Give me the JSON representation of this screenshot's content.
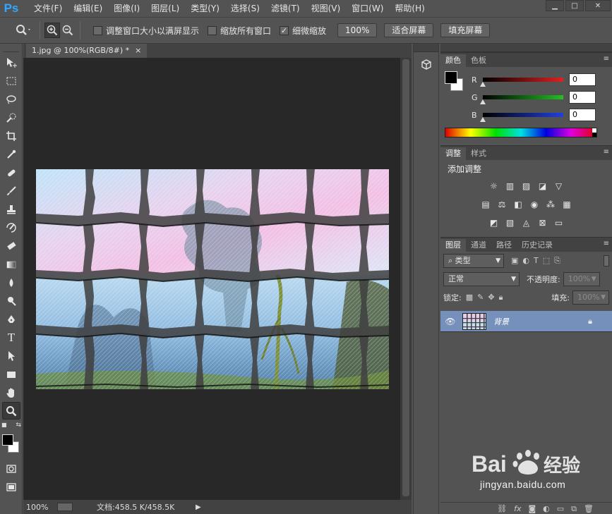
{
  "app": {
    "logo": "Ps",
    "menu": [
      "文件(F)",
      "编辑(E)",
      "图像(I)",
      "图层(L)",
      "类型(Y)",
      "选择(S)",
      "滤镜(T)",
      "视图(V)",
      "窗口(W)",
      "帮助(H)"
    ],
    "window_controls": [
      "minimize-icon",
      "restore-icon",
      "close-icon"
    ]
  },
  "options": {
    "tool_icon": "zoom-icon",
    "checkboxes": [
      {
        "label": "调整窗口大小以满屏显示",
        "checked": false
      },
      {
        "label": "缩放所有窗口",
        "checked": false
      },
      {
        "label": "细微缩放",
        "checked": true
      }
    ],
    "buttons": [
      "100%",
      "适合屏幕",
      "填充屏幕"
    ]
  },
  "document": {
    "tab_title": "1.jpg @ 100%(RGB/8#) *",
    "tab_close": "×",
    "zoom": "100%",
    "doc_info": "文档:458.5 K/458.5K"
  },
  "panels": {
    "color": {
      "tabs": [
        "颜色",
        "色板"
      ],
      "channels": [
        {
          "label": "R",
          "value": "0",
          "color": "#e02020"
        },
        {
          "label": "G",
          "value": "0",
          "color": "#20c020"
        },
        {
          "label": "B",
          "value": "0",
          "color": "#2040e0"
        }
      ]
    },
    "adjustments": {
      "tabs": [
        "调整",
        "样式"
      ],
      "title": "添加调整"
    },
    "layers": {
      "tabs": [
        "图层",
        "通道",
        "路径",
        "历史记录"
      ],
      "filter_kind": "类型",
      "blend_mode": "正常",
      "opacity_label": "不透明度:",
      "opacity_value": "100%",
      "lock_label": "锁定:",
      "fill_label": "填充:",
      "fill_value": "100%",
      "layer_name": "背景"
    }
  },
  "watermark": {
    "url": "jingyan.baidu.com"
  }
}
